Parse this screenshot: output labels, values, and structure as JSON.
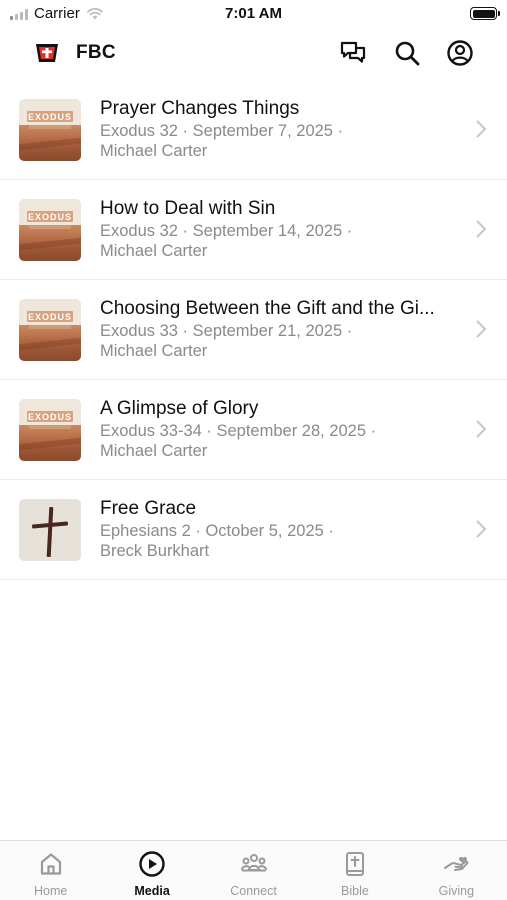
{
  "status_bar": {
    "carrier": "Carrier",
    "time": "7:01 AM"
  },
  "header": {
    "title": "FBC"
  },
  "sermons": [
    {
      "title": "Prayer Changes Things",
      "meta_line1": "Exodus 32 · September 7, 2025 ·",
      "meta_line2": "Michael Carter",
      "thumb_text": "EXODUS"
    },
    {
      "title": "How to Deal with Sin",
      "meta_line1": "Exodus 32 · September 14, 2025 ·",
      "meta_line2": "Michael Carter",
      "thumb_text": "EXODUS"
    },
    {
      "title": "Choosing Between the Gift and the Gi...",
      "meta_line1": "Exodus 33 · September 21, 2025 ·",
      "meta_line2": "Michael Carter",
      "thumb_text": "EXODUS"
    },
    {
      "title": "A Glimpse of Glory",
      "meta_line1": "Exodus 33-34 · September 28, 2025 ·",
      "meta_line2": "Michael Carter",
      "thumb_text": "EXODUS"
    },
    {
      "title": "Free Grace",
      "meta_line1": "Ephesians 2 · October 5, 2025 ·",
      "meta_line2": "Breck Burkhart"
    }
  ],
  "tabbar": {
    "tabs": [
      {
        "label": "Home",
        "icon": "home-icon"
      },
      {
        "label": "Media",
        "icon": "play-circle-icon",
        "active": true
      },
      {
        "label": "Connect",
        "icon": "group-icon"
      },
      {
        "label": "Bible",
        "icon": "bible-icon"
      },
      {
        "label": "Giving",
        "icon": "giving-hand-icon"
      }
    ]
  },
  "colors": {
    "accent": "#111111",
    "logo_red": "#e2312d",
    "meta_gray": "#8a8a8e",
    "tab_inactive": "#9a9a9a"
  }
}
